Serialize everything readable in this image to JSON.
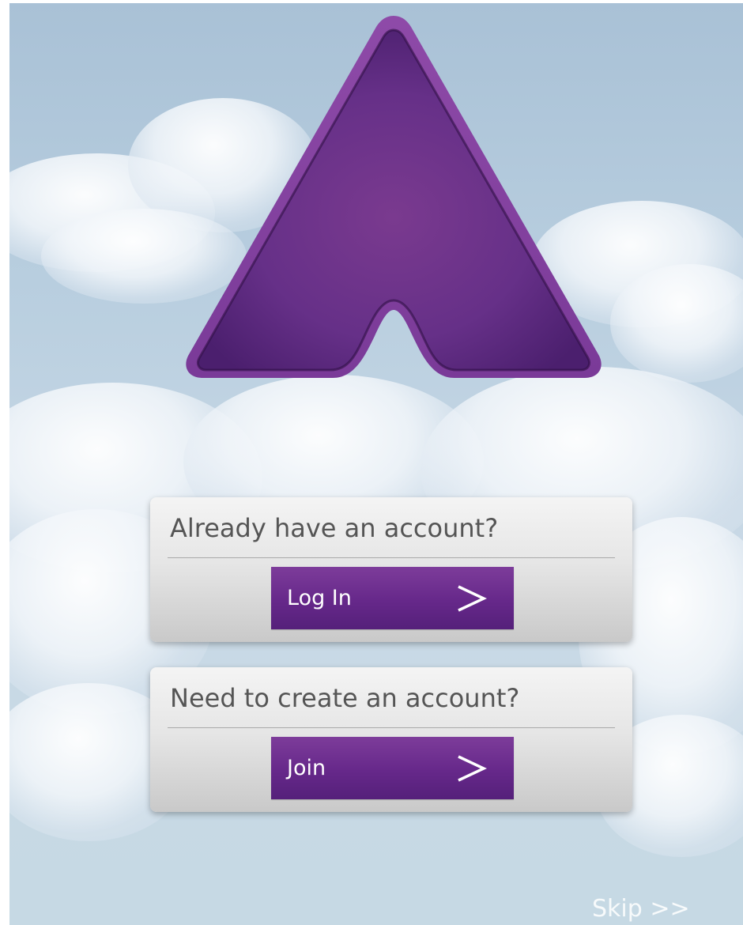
{
  "login_card": {
    "title": "Already have an account?",
    "button_label": "Log In"
  },
  "join_card": {
    "title": "Need to create an account?",
    "button_label": "Join"
  },
  "skip_label": "Skip >>",
  "icons": {
    "logo": "triangle-a-logo-icon",
    "button_arrow": "chevron-right-icon"
  },
  "colors": {
    "brand_purple": "#6a2c8e",
    "sky": "#b8cedf",
    "card": "#e6e6e6",
    "card_text": "#555555"
  }
}
